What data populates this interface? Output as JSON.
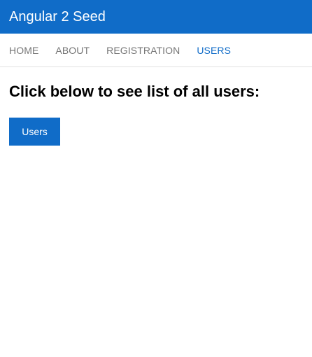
{
  "header": {
    "title": "Angular 2 Seed",
    "background_color": "#106cc8"
  },
  "nav": {
    "items": [
      {
        "label": "HOME",
        "active": false
      },
      {
        "label": "ABOUT",
        "active": false
      },
      {
        "label": "REGISTRATION",
        "active": false
      },
      {
        "label": "USERS",
        "active": true
      }
    ],
    "active_color": "#106cc8",
    "inactive_color": "#757575"
  },
  "main": {
    "heading": "Click below to see list of all users:",
    "users_button_label": "Users"
  }
}
